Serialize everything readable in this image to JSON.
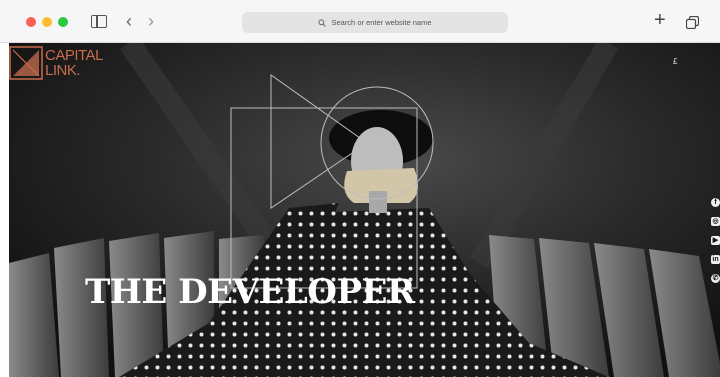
{
  "browser": {
    "address_placeholder": "Search or enter website name",
    "new_tab_label": "+"
  },
  "site": {
    "logo_line1": "CAPITAL",
    "logo_line2": "LINK.",
    "menu_glyph": "£",
    "headline": "THE DEVELOPER",
    "social": [
      "f",
      "◎",
      "▶",
      "in",
      "✆"
    ],
    "brand_color": "#c86c4c"
  }
}
